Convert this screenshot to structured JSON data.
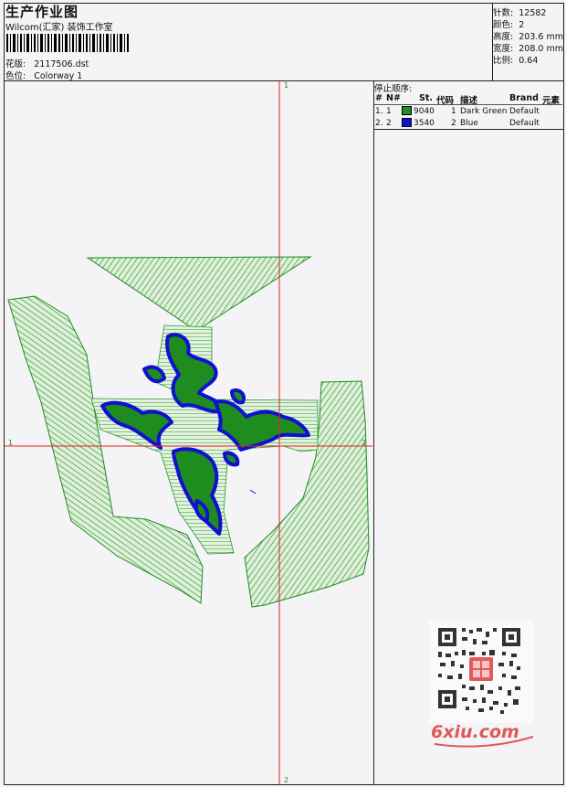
{
  "header": {
    "title": "生产作业图",
    "company": "Wilcom(汇家) 装饰工作室",
    "design_label": "花版:",
    "design_value": "2117506.dst",
    "colorway_label": "色位:",
    "colorway_value": "Colorway 1"
  },
  "stats": [
    {
      "label": "针数:",
      "value": "12582"
    },
    {
      "label": "颜色:",
      "value": "2"
    },
    {
      "label": "高度:",
      "value": "203.6 mm"
    },
    {
      "label": "宽度:",
      "value": "208.0 mm"
    },
    {
      "label": "比例:",
      "value": "0.64"
    }
  ],
  "stop_sequence": {
    "title": "停止顺序:",
    "columns": [
      "#",
      "N#",
      "St.",
      "代码",
      "描述",
      "Brand",
      "元素"
    ],
    "rows": [
      {
        "index": "1.",
        "n": "1",
        "color": "#1e8c1e",
        "stitches": "9040",
        "code": "1",
        "description": "Dark Green",
        "brand": "Default"
      },
      {
        "index": "2.",
        "n": "2",
        "color": "#1010d0",
        "stitches": "3540",
        "code": "2",
        "description": "Blue",
        "brand": "Default"
      }
    ]
  },
  "markers": {
    "top": "1",
    "bottom": "2",
    "left": "1",
    "right": "2"
  },
  "watermark": {
    "text": "6xiu.com"
  },
  "colors": {
    "green": "#1e8c1e",
    "blue": "#1010d0",
    "crosshair": "#e02020"
  }
}
